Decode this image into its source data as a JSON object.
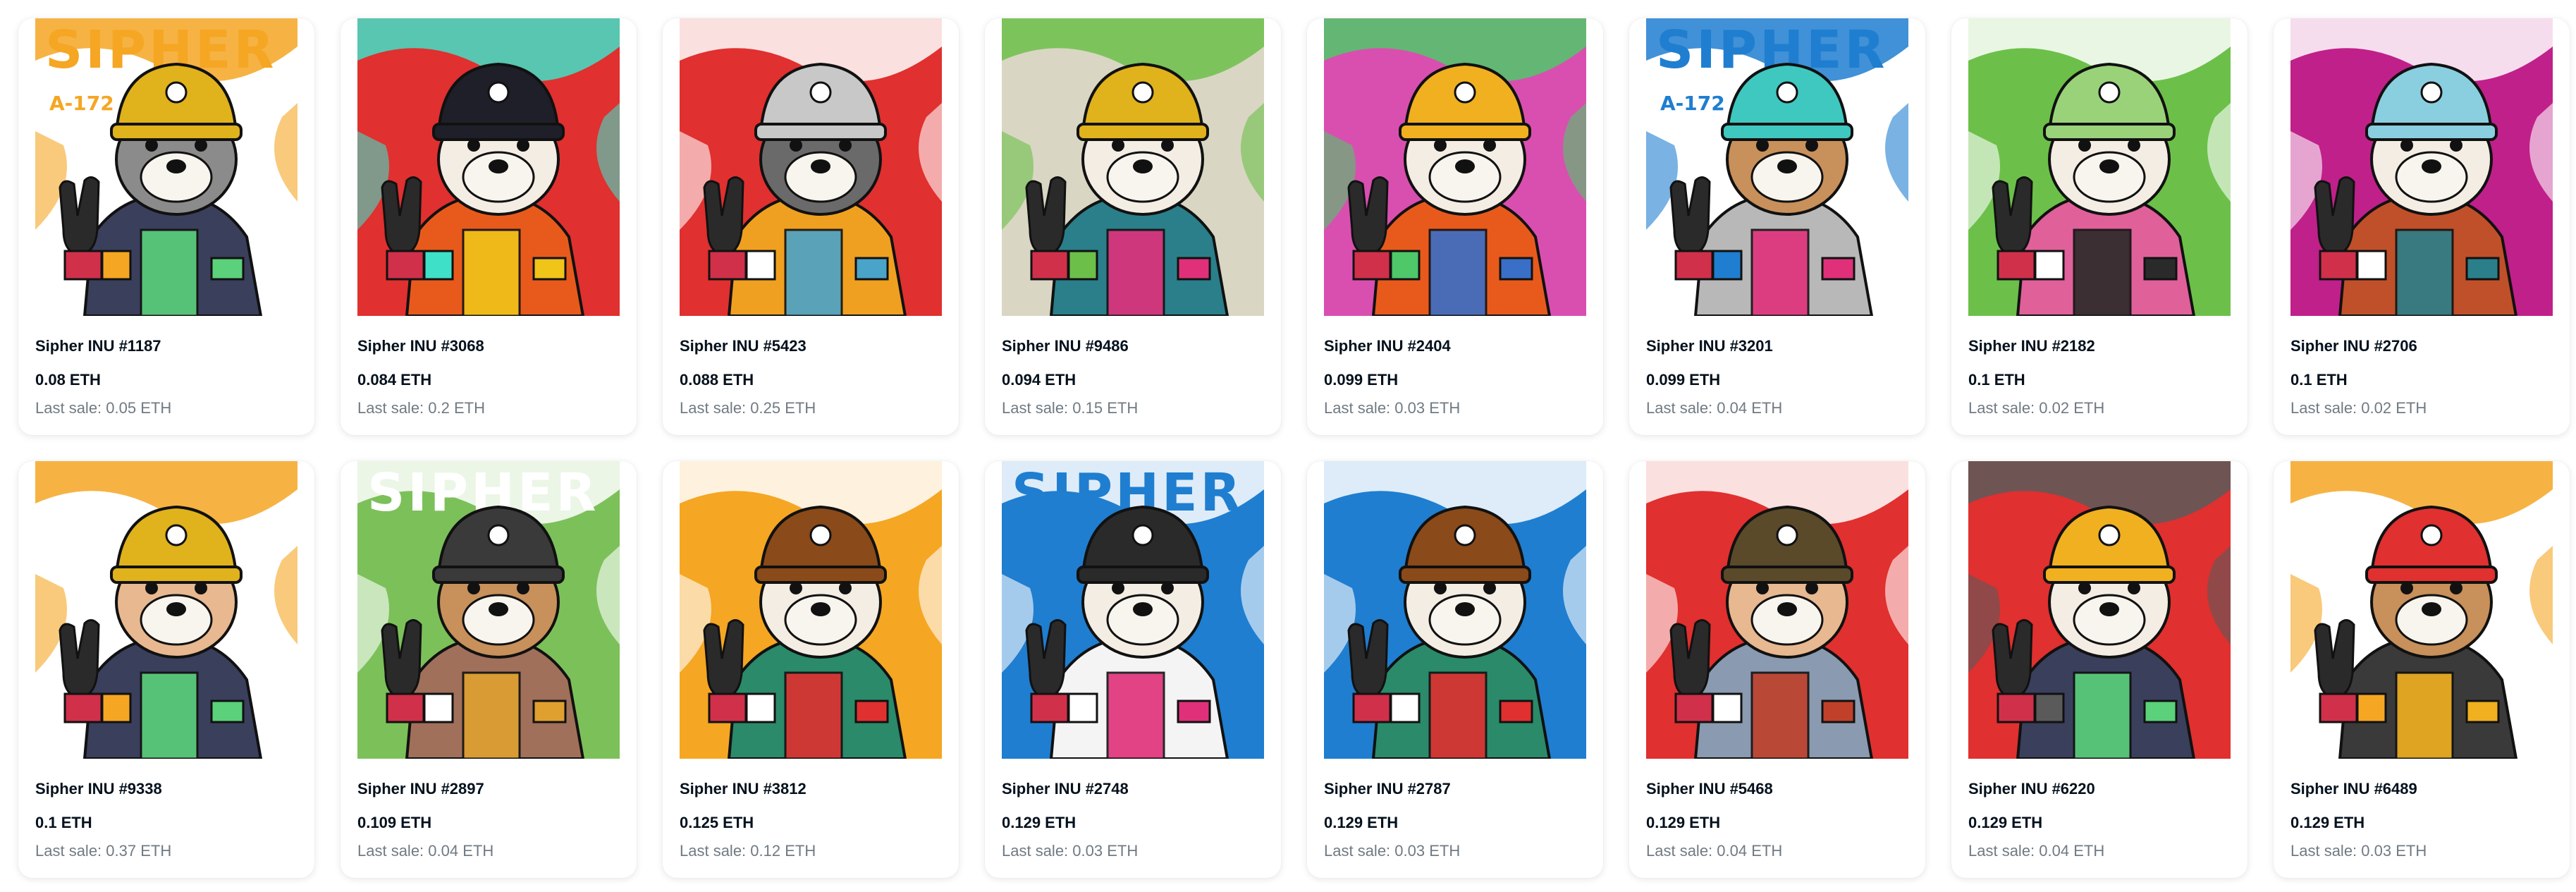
{
  "items": [
    {
      "name": "Sipher INU #1187",
      "price": "0.08 ETH",
      "last_sale": "Last sale: 0.05 ETH",
      "art": {
        "bg": "#ffffff",
        "accent": "#f5a623",
        "body": "#3a3f5c",
        "hat": "#e0b21c",
        "fur": "#8b8b8b",
        "detail": "#5ad17a",
        "banner": "SIPHER",
        "banner_color": "#f5a623",
        "subtitle": "A-172"
      }
    },
    {
      "name": "Sipher INU #3068",
      "price": "0.084 ETH",
      "last_sale": "Last sale: 0.2 ETH",
      "art": {
        "bg": "#e0302f",
        "accent": "#3fe0c8",
        "body": "#e85a1c",
        "hat": "#1f1f2a",
        "fur": "#f4ede4",
        "detail": "#f0c419",
        "banner": "",
        "banner_color": "#3fe0c8",
        "subtitle": ""
      }
    },
    {
      "name": "Sipher INU #5423",
      "price": "0.088 ETH",
      "last_sale": "Last sale: 0.25 ETH",
      "art": {
        "bg": "#e0302f",
        "accent": "#ffffff",
        "body": "#f0a020",
        "hat": "#c8c8c8",
        "fur": "#6a6a6a",
        "detail": "#4aa3c8",
        "banner": "",
        "banner_color": "#ffffff",
        "subtitle": ""
      }
    },
    {
      "name": "Sipher INU #9486",
      "price": "0.094 ETH",
      "last_sale": "Last sale: 0.15 ETH",
      "art": {
        "bg": "#d9d6c3",
        "accent": "#6cc04a",
        "body": "#2a7f8a",
        "hat": "#e0b21c",
        "fur": "#f4ede4",
        "detail": "#e0307a",
        "banner": "",
        "banner_color": "#6cc04a",
        "subtitle": ""
      }
    },
    {
      "name": "Sipher INU #2404",
      "price": "0.099 ETH",
      "last_sale": "Last sale: 0.03 ETH",
      "art": {
        "bg": "#d94fb0",
        "accent": "#4fc86a",
        "body": "#e85a1c",
        "hat": "#f0b020",
        "fur": "#f4ede4",
        "detail": "#3a6fc8",
        "banner": "",
        "banner_color": "#4fc86a",
        "subtitle": ""
      }
    },
    {
      "name": "Sipher INU #3201",
      "price": "0.099 ETH",
      "last_sale": "Last sale: 0.04 ETH",
      "art": {
        "bg": "#ffffff",
        "accent": "#1f7ed0",
        "body": "#b8b8b8",
        "hat": "#3fc8c0",
        "fur": "#c8905a",
        "detail": "#e0307a",
        "banner": "SIPHER",
        "banner_color": "#1f7ed0",
        "subtitle": "A-172"
      }
    },
    {
      "name": "Sipher INU #2182",
      "price": "0.1 ETH",
      "last_sale": "Last sale: 0.02 ETH",
      "art": {
        "bg": "#6cc04a",
        "accent": "#ffffff",
        "body": "#e0609a",
        "hat": "#9ad27a",
        "fur": "#f4ede4",
        "detail": "#2a2a2a",
        "banner": "",
        "banner_color": "#ffffff",
        "subtitle": ""
      }
    },
    {
      "name": "Sipher INU #2706",
      "price": "0.1 ETH",
      "last_sale": "Last sale: 0.02 ETH",
      "art": {
        "bg": "#c0208a",
        "accent": "#ffffff",
        "body": "#c0502a",
        "hat": "#8acfe0",
        "fur": "#f4ede4",
        "detail": "#2a7f8a",
        "banner": "",
        "banner_color": "#ffffff",
        "subtitle": ""
      }
    },
    {
      "name": "Sipher INU #9338",
      "price": "0.1 ETH",
      "last_sale": "Last sale: 0.37 ETH",
      "art": {
        "bg": "#ffffff",
        "accent": "#f5a623",
        "body": "#3a3f5c",
        "hat": "#e0b21c",
        "fur": "#e8b890",
        "detail": "#5ad17a",
        "banner": "",
        "banner_color": "#f5a623",
        "subtitle": ""
      }
    },
    {
      "name": "Sipher INU #2897",
      "price": "0.109 ETH",
      "last_sale": "Last sale: 0.04 ETH",
      "art": {
        "bg": "#7cc05a",
        "accent": "#ffffff",
        "body": "#a0705a",
        "hat": "#3a3a3a",
        "fur": "#c8905a",
        "detail": "#e0a030",
        "banner": "SIPHER",
        "banner_color": "#ffffff",
        "subtitle": ""
      }
    },
    {
      "name": "Sipher INU #3812",
      "price": "0.125 ETH",
      "last_sale": "Last sale: 0.12 ETH",
      "art": {
        "bg": "#f5a623",
        "accent": "#ffffff",
        "body": "#2a8a6a",
        "hat": "#8a4a1a",
        "fur": "#f4ede4",
        "detail": "#e0302f",
        "banner": "",
        "banner_color": "#ffffff",
        "subtitle": ""
      }
    },
    {
      "name": "Sipher INU #2748",
      "price": "0.129 ETH",
      "last_sale": "Last sale: 0.03 ETH",
      "art": {
        "bg": "#1f7ed0",
        "accent": "#ffffff",
        "body": "#f4f4f4",
        "hat": "#2a2a2a",
        "fur": "#f4ede4",
        "detail": "#e0307a",
        "banner": "SIPHER",
        "banner_color": "#1f7ed0",
        "subtitle": ""
      }
    },
    {
      "name": "Sipher INU #2787",
      "price": "0.129 ETH",
      "last_sale": "Last sale: 0.03 ETH",
      "art": {
        "bg": "#1f7ed0",
        "accent": "#ffffff",
        "body": "#2a8a6a",
        "hat": "#8a4a1a",
        "fur": "#f4ede4",
        "detail": "#e0302f",
        "banner": "",
        "banner_color": "#ffffff",
        "subtitle": ""
      }
    },
    {
      "name": "Sipher INU #5468",
      "price": "0.129 ETH",
      "last_sale": "Last sale: 0.04 ETH",
      "art": {
        "bg": "#e0302f",
        "accent": "#ffffff",
        "body": "#8a9ab0",
        "hat": "#5a4a2a",
        "fur": "#e8b890",
        "detail": "#c0402a",
        "banner": "",
        "banner_color": "#ffffff",
        "subtitle": ""
      }
    },
    {
      "name": "Sipher INU #6220",
      "price": "0.129 ETH",
      "last_sale": "Last sale: 0.04 ETH",
      "art": {
        "bg": "#e0302f",
        "accent": "#5a5a5a",
        "body": "#3a3f5c",
        "hat": "#f0b020",
        "fur": "#f4ede4",
        "detail": "#5ad17a",
        "banner": "",
        "banner_color": "#5a5a5a",
        "subtitle": ""
      }
    },
    {
      "name": "Sipher INU #6489",
      "price": "0.129 ETH",
      "last_sale": "Last sale: 0.03 ETH",
      "art": {
        "bg": "#ffffff",
        "accent": "#f5a623",
        "body": "#3a3a3a",
        "hat": "#e0302f",
        "fur": "#c8905a",
        "detail": "#f0b020",
        "banner": "",
        "banner_color": "#f5a623",
        "subtitle": ""
      }
    }
  ]
}
